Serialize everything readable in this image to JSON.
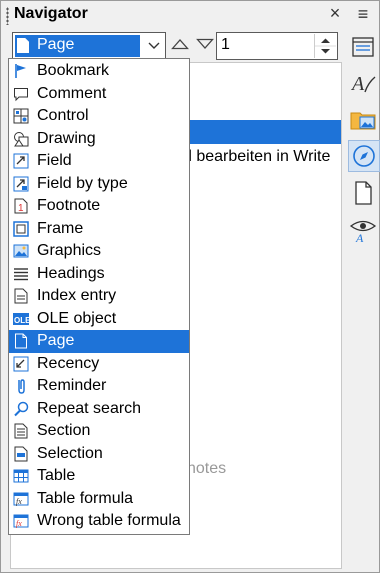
{
  "navigator": {
    "title": "Navigator",
    "close_glyph": "×",
    "menu_glyph": "≡"
  },
  "toolbar": {
    "navigate_by": "Page",
    "page_number": "1"
  },
  "background": {
    "line1": "d bearbeiten in Write",
    "line2": "notes"
  },
  "dropdown": {
    "items": [
      {
        "label": "Bookmark",
        "icon": "bookmark-icon"
      },
      {
        "label": "Comment",
        "icon": "comment-icon"
      },
      {
        "label": "Control",
        "icon": "control-icon"
      },
      {
        "label": "Drawing",
        "icon": "drawing-icon"
      },
      {
        "label": "Field",
        "icon": "field-icon"
      },
      {
        "label": "Field by type",
        "icon": "field-by-type-icon"
      },
      {
        "label": "Footnote",
        "icon": "footnote-icon"
      },
      {
        "label": "Frame",
        "icon": "frame-icon"
      },
      {
        "label": "Graphics",
        "icon": "graphics-icon"
      },
      {
        "label": "Headings",
        "icon": "headings-icon"
      },
      {
        "label": "Index entry",
        "icon": "index-entry-icon"
      },
      {
        "label": "OLE object",
        "icon": "ole-object-icon"
      },
      {
        "label": "Page",
        "icon": "page-icon",
        "selected": true
      },
      {
        "label": "Recency",
        "icon": "recency-icon"
      },
      {
        "label": "Reminder",
        "icon": "reminder-icon"
      },
      {
        "label": "Repeat search",
        "icon": "repeat-search-icon"
      },
      {
        "label": "Section",
        "icon": "section-icon"
      },
      {
        "label": "Selection",
        "icon": "selection-icon"
      },
      {
        "label": "Table",
        "icon": "table-icon"
      },
      {
        "label": "Table formula",
        "icon": "table-formula-icon"
      },
      {
        "label": "Wrong table formula",
        "icon": "wrong-table-formula-icon"
      }
    ]
  },
  "sidebar": {
    "buttons": [
      {
        "icon": "properties-icon"
      },
      {
        "icon": "styles-icon"
      },
      {
        "icon": "gallery-icon"
      },
      {
        "icon": "navigator-icon",
        "active": true
      },
      {
        "icon": "page-icon"
      },
      {
        "icon": "style-inspector-icon"
      }
    ]
  },
  "colors": {
    "accent": "#1e73d8",
    "frame_border": "#9a9a9a",
    "background": "#f0f0f0"
  }
}
